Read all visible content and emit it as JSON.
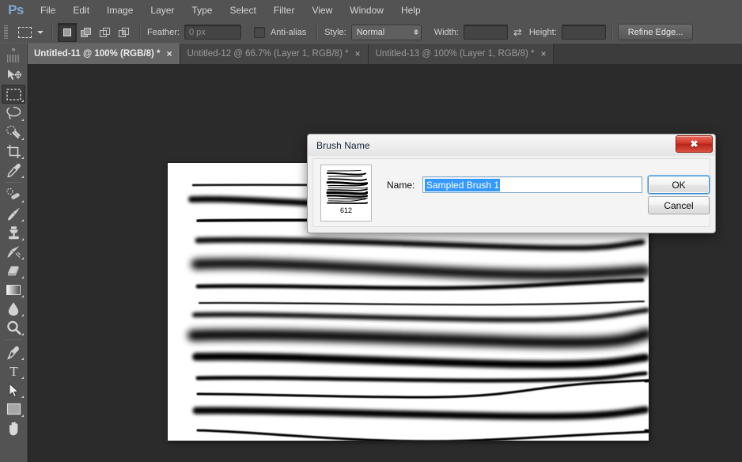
{
  "app": {
    "name": "Adobe Photoshop",
    "logo_text": "Ps"
  },
  "menubar": {
    "items": [
      {
        "label": "File"
      },
      {
        "label": "Edit"
      },
      {
        "label": "Image"
      },
      {
        "label": "Layer"
      },
      {
        "label": "Type"
      },
      {
        "label": "Select"
      },
      {
        "label": "Filter"
      },
      {
        "label": "View"
      },
      {
        "label": "Window"
      },
      {
        "label": "Help"
      }
    ]
  },
  "options_bar": {
    "tool_icon": "rectangular-marquee-icon",
    "selection_modes": [
      {
        "name": "new-selection",
        "active": true
      },
      {
        "name": "add-to-selection",
        "active": false
      },
      {
        "name": "subtract-from-selection",
        "active": false
      },
      {
        "name": "intersect-with-selection",
        "active": false
      }
    ],
    "feather_label": "Feather:",
    "feather_value": "0 px",
    "antialias_label": "Anti-alias",
    "antialias_checked": false,
    "style_label": "Style:",
    "style_value": "Normal",
    "width_label": "Width:",
    "width_value": "",
    "height_label": "Height:",
    "height_value": "",
    "swap_icon": "swap-dimensions-icon",
    "refine_edge_label": "Refine Edge..."
  },
  "tabs": [
    {
      "label": "Untitled-11 @ 100% (RGB/8) *",
      "active": true,
      "close": "×"
    },
    {
      "label": "Untitled-12 @ 66.7% (Layer 1, RGB/8) *",
      "active": false,
      "close": "×"
    },
    {
      "label": "Untitled-13 @ 100% (Layer 1, RGB/8) *",
      "active": false,
      "close": "×"
    }
  ],
  "toolbar": {
    "collapse_icon": "collapse-panel-icon",
    "grip": "drag-handle-icon",
    "tools": [
      {
        "name": "move-tool",
        "active": false,
        "has_flyout": false
      },
      {
        "name": "rectangular-marquee-tool",
        "active": true,
        "has_flyout": true
      },
      {
        "name": "lasso-tool",
        "active": false,
        "has_flyout": true
      },
      {
        "name": "quick-selection-tool",
        "active": false,
        "has_flyout": true
      },
      {
        "name": "crop-tool",
        "active": false,
        "has_flyout": true
      },
      {
        "name": "eyedropper-tool",
        "active": false,
        "has_flyout": true
      },
      {
        "name": "spot-healing-brush-tool",
        "active": false,
        "has_flyout": true
      },
      {
        "name": "brush-tool",
        "active": false,
        "has_flyout": true
      },
      {
        "name": "clone-stamp-tool",
        "active": false,
        "has_flyout": true
      },
      {
        "name": "history-brush-tool",
        "active": false,
        "has_flyout": true
      },
      {
        "name": "eraser-tool",
        "active": false,
        "has_flyout": true
      },
      {
        "name": "gradient-tool",
        "active": false,
        "has_flyout": true
      },
      {
        "name": "blur-tool",
        "active": false,
        "has_flyout": true
      },
      {
        "name": "zoom-tool",
        "active": false,
        "has_flyout": true
      },
      {
        "name": "pen-tool",
        "active": false,
        "has_flyout": true
      },
      {
        "name": "type-tool",
        "active": false,
        "has_flyout": true
      },
      {
        "name": "path-selection-tool",
        "active": false,
        "has_flyout": true
      },
      {
        "name": "rectangle-shape-tool",
        "active": false,
        "has_flyout": true
      },
      {
        "name": "hand-tool",
        "active": false,
        "has_flyout": false
      }
    ]
  },
  "canvas": {
    "description": "White document with black horizontal brush strokes of varying thickness and softness"
  },
  "dialog": {
    "title": "Brush Name",
    "close_label": "✖",
    "preview": {
      "name": "brush-preview-thumbnail",
      "size_label": "612"
    },
    "name_label": "Name:",
    "name_value": "Sampled Brush 1",
    "name_selected": true,
    "buttons": [
      {
        "name": "ok-button",
        "label": "OK",
        "default": true
      },
      {
        "name": "cancel-button",
        "label": "Cancel",
        "default": false
      }
    ]
  },
  "colors": {
    "chrome": "#535353",
    "workspace": "#2b2b2b",
    "tab_active": "#666666",
    "accent_logo": "#7fa8d0",
    "selection_blue": "#3399ff",
    "close_red": "#d2392a"
  }
}
